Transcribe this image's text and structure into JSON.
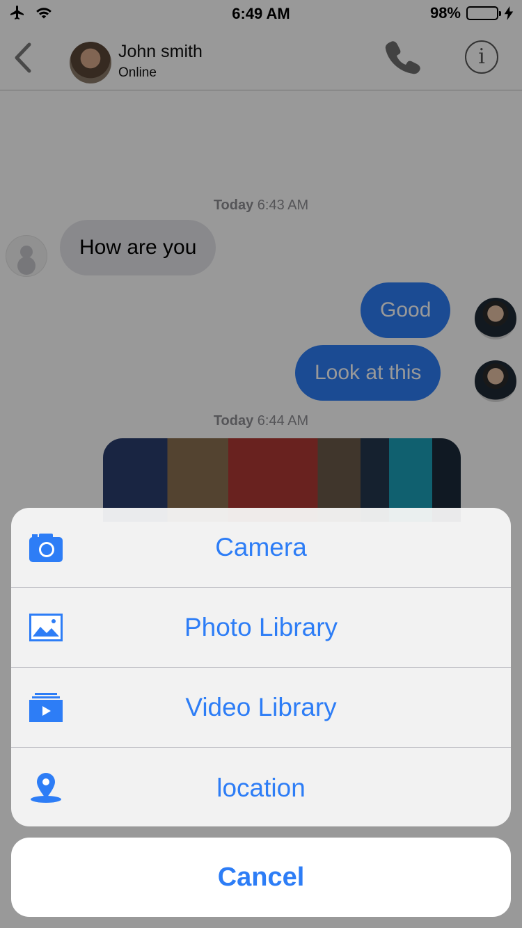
{
  "status_bar": {
    "time": "6:49 AM",
    "battery": "98%",
    "battery_level": 0.98
  },
  "header": {
    "contact_name": "John  smith",
    "contact_status": "Online",
    "icons": [
      "back-chevron-icon",
      "phone-icon",
      "info-icon"
    ]
  },
  "chat": {
    "timestamps": [
      {
        "day": "Today",
        "time": "6:43 AM"
      },
      {
        "day": "Today",
        "time": "6:44 AM"
      }
    ],
    "messages": [
      {
        "direction": "incoming",
        "text": "How are you"
      },
      {
        "direction": "outgoing",
        "text": "Good"
      },
      {
        "direction": "outgoing",
        "text": "Look at this"
      }
    ]
  },
  "action_sheet": {
    "items": [
      {
        "label": "Camera",
        "icon": "camera-icon"
      },
      {
        "label": "Photo Library",
        "icon": "photo-library-icon"
      },
      {
        "label": "Video Library",
        "icon": "video-library-icon"
      },
      {
        "label": "location",
        "icon": "location-pin-icon"
      }
    ],
    "cancel_label": "Cancel"
  },
  "colors": {
    "accent": "#2d7df6",
    "incoming_bubble": "#e5e5ea",
    "battery_green": "#4cd964"
  }
}
